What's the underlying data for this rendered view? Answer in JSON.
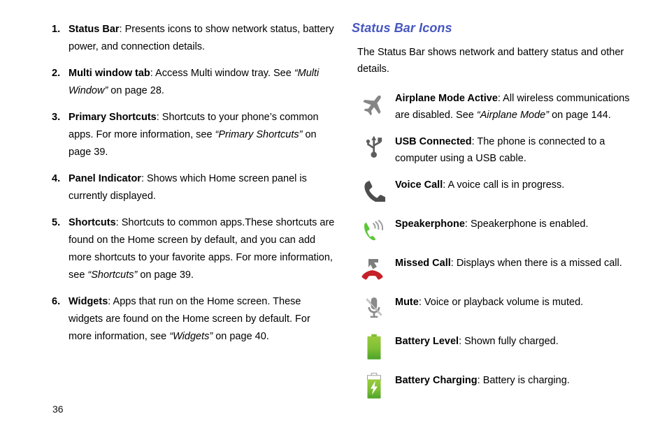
{
  "page": {
    "number": "36",
    "accent_heading_color": "#4757c0"
  },
  "left_column": {
    "items": [
      {
        "marker": "1.",
        "term": "Status Bar",
        "body": ": Presents icons to show network status, battery power, and connection details."
      },
      {
        "marker": "2.",
        "term": "Multi window tab",
        "body": ": Access Multi window tray. See ",
        "ref": "“Multi Window”",
        "body_after": " on page 28."
      },
      {
        "marker": "3.",
        "term": "Primary Shortcuts",
        "body": ": Shortcuts to your phone’s common apps. For more information, see ",
        "ref": "“Primary Shortcuts”",
        "body_after": " on page 39."
      },
      {
        "marker": "4.",
        "term": "Panel Indicator",
        "body": ": Shows which Home screen panel is currently displayed."
      },
      {
        "marker": "5.",
        "term": "Shortcuts",
        "body": ": Shortcuts to common apps.These shortcuts are found on the Home screen by default, and you can add more shortcuts to your favorite apps. For more information, see ",
        "ref": "“Shortcuts”",
        "body_after": " on page 39."
      },
      {
        "marker": "6.",
        "term": "Widgets",
        "body": ": Apps that run on the Home screen. These widgets are found on the Home screen by default. For more information, see ",
        "ref": "“Widgets”",
        "body_after": " on page 40."
      }
    ]
  },
  "right_column": {
    "heading": "Status Bar Icons",
    "intro": "The Status Bar shows network and battery status and other details.",
    "icons": [
      {
        "icon": "airplane-icon",
        "term": "Airplane Mode Active",
        "body": ": All wireless communications are disabled. See ",
        "ref": "“Airplane Mode”",
        "body_after": " on page 144.",
        "color": "#858585"
      },
      {
        "icon": "usb-icon",
        "term": "USB Connected",
        "body": ": The phone is connected to a computer using a USB cable.",
        "color": "#5d5d5d"
      },
      {
        "icon": "voice-call-icon",
        "term": "Voice Call",
        "body": ": A voice call is in progress.",
        "color": "#4d4d4d"
      },
      {
        "icon": "speakerphone-icon",
        "term": "Speakerphone",
        "body": ": Speakerphone is enabled.",
        "color": "#5dc63a"
      },
      {
        "icon": "missed-call-icon",
        "term": "Missed Call",
        "body": ": Displays when there is a missed call.",
        "color": "#c62028"
      },
      {
        "icon": "mute-icon",
        "term": "Mute",
        "body": ": Voice or playback volume is muted.",
        "color": "#8a8a8a"
      },
      {
        "icon": "battery-level-icon",
        "term": "Battery Level",
        "body": ": Shown fully charged.",
        "color": "#76bf2e"
      },
      {
        "icon": "battery-charging-icon",
        "term": "Battery Charging",
        "body": ": Battery is charging.",
        "color": "#76bf2e"
      }
    ]
  }
}
